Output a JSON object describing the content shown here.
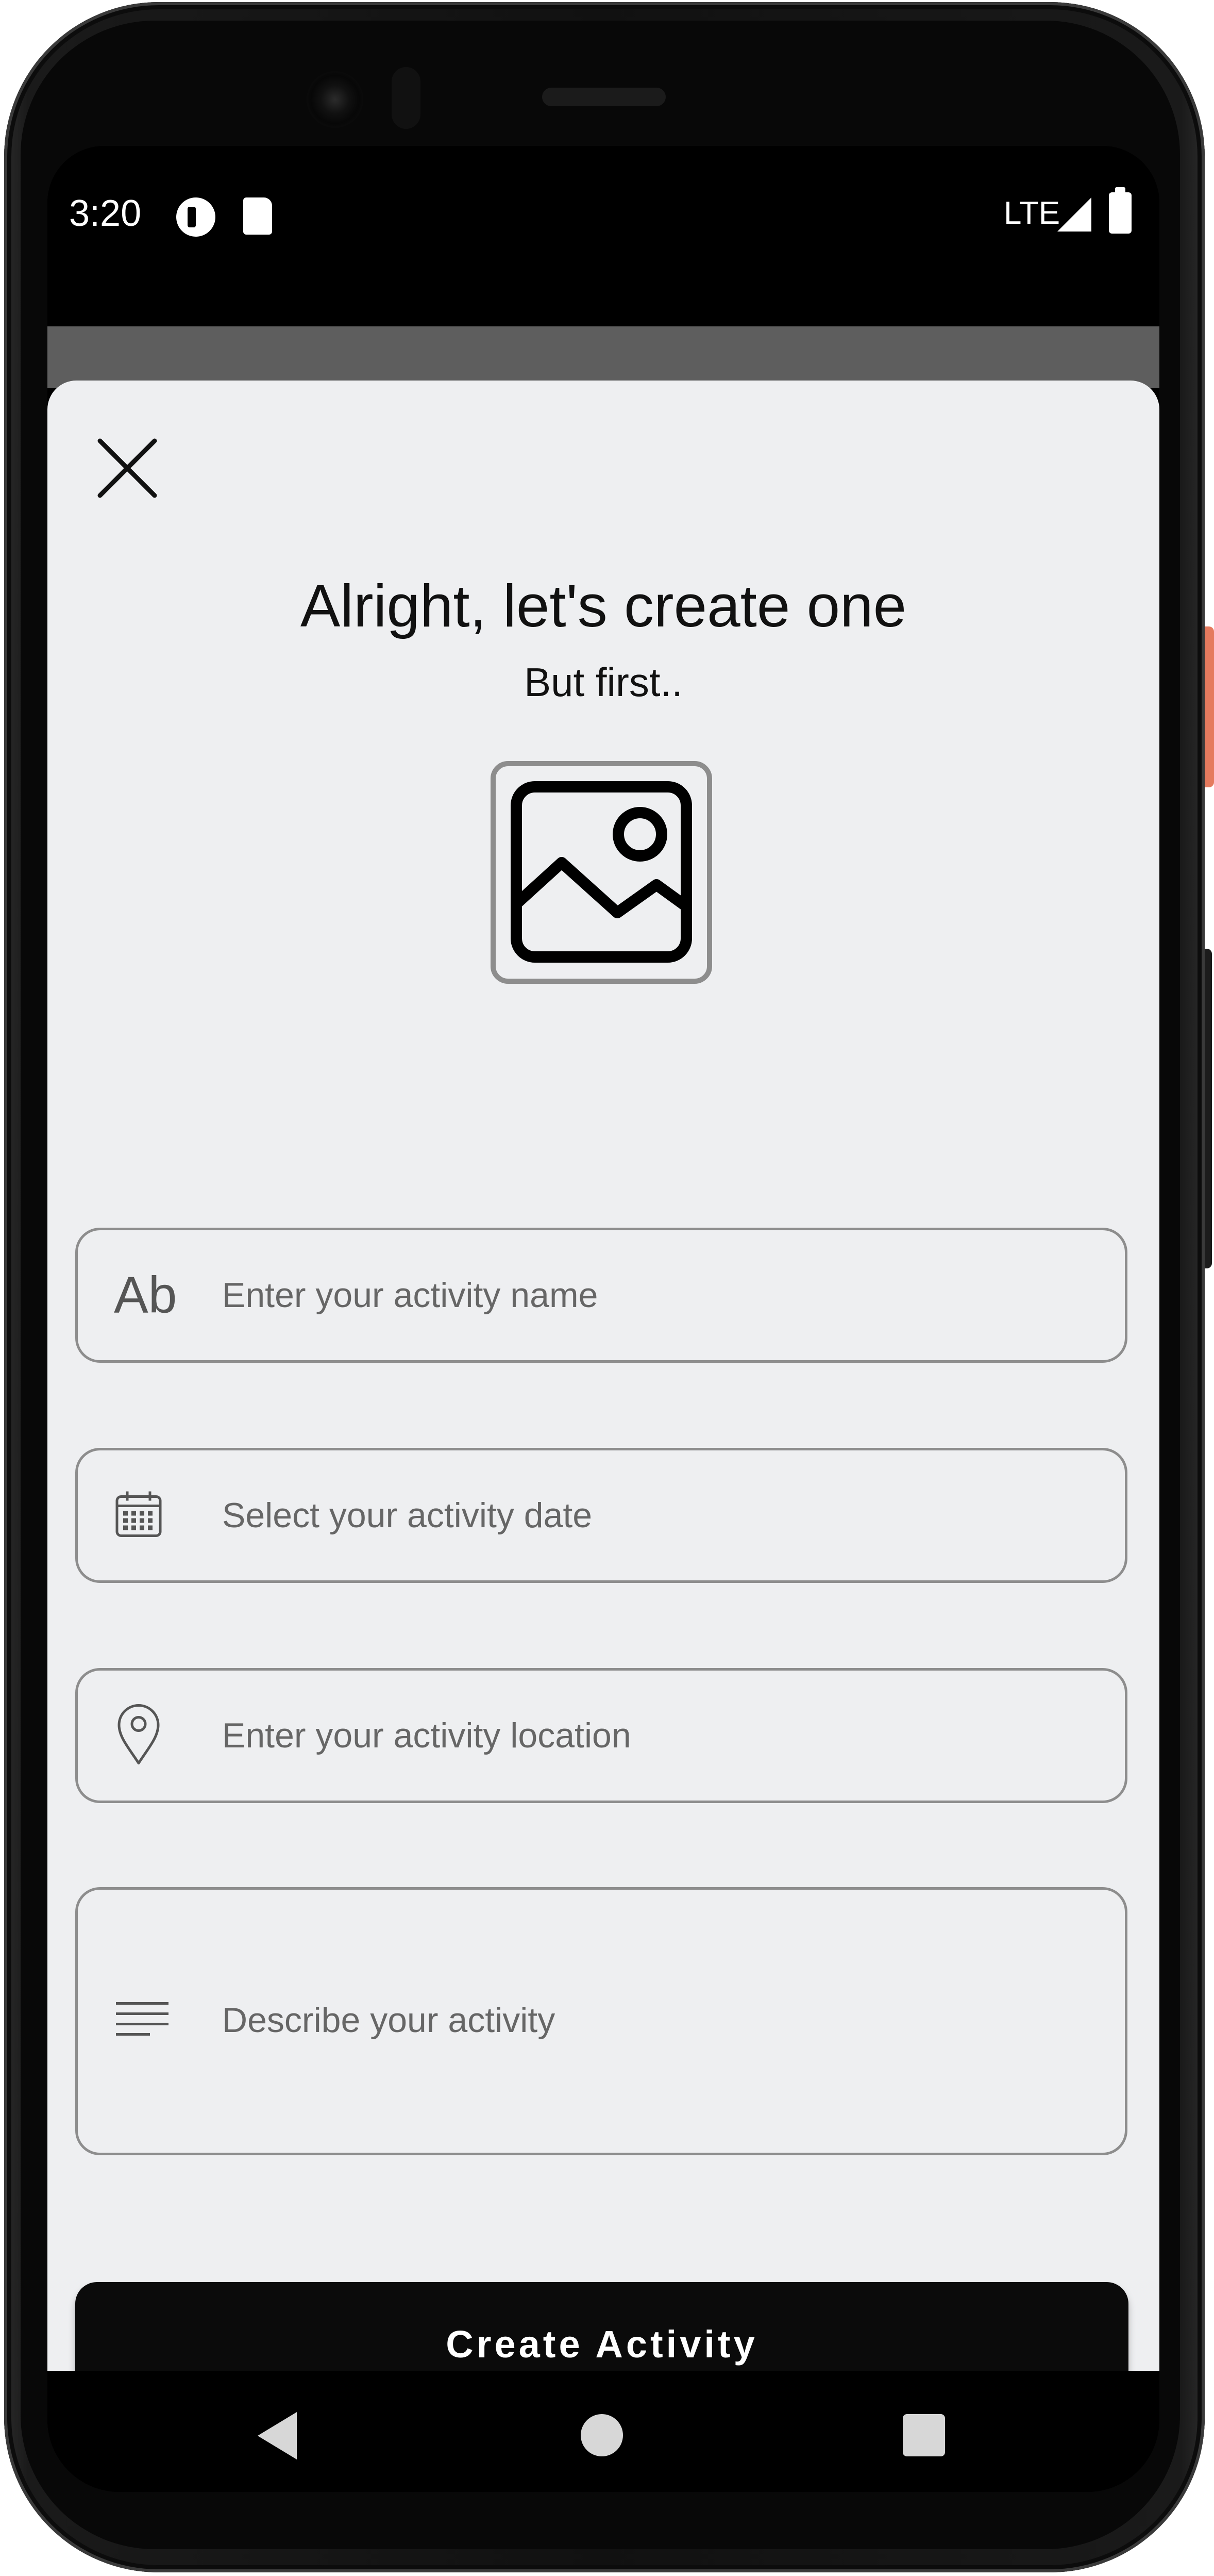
{
  "status_bar": {
    "time": "3:20",
    "network": "LTE",
    "icons": [
      "notification-app-icon",
      "sd-card-icon",
      "signal-icon",
      "battery-icon"
    ]
  },
  "sheet": {
    "title": "Alright, let's create one",
    "subtitle": "But first..",
    "image_picker_icon": "image-placeholder-icon",
    "fields": {
      "name": {
        "icon_text": "Ab",
        "placeholder": "Enter your activity name",
        "value": ""
      },
      "date": {
        "icon": "calendar-icon",
        "placeholder": "Select your activity date",
        "value": ""
      },
      "location": {
        "icon": "location-pin-icon",
        "placeholder": "Enter your activity location",
        "value": ""
      },
      "description": {
        "icon": "text-lines-icon",
        "placeholder": "Describe your activity",
        "value": ""
      }
    },
    "submit_label": "Create Activity"
  },
  "colors": {
    "sheet_background": "#eeeff1",
    "button_background": "#0b0b0b",
    "button_text": "#ffffff",
    "field_border": "#8d8d8d",
    "placeholder_text": "#666666",
    "accent_side_button": "#e57a5e"
  },
  "nav_bar": {
    "buttons": [
      "back-icon",
      "home-icon",
      "recents-icon"
    ]
  }
}
